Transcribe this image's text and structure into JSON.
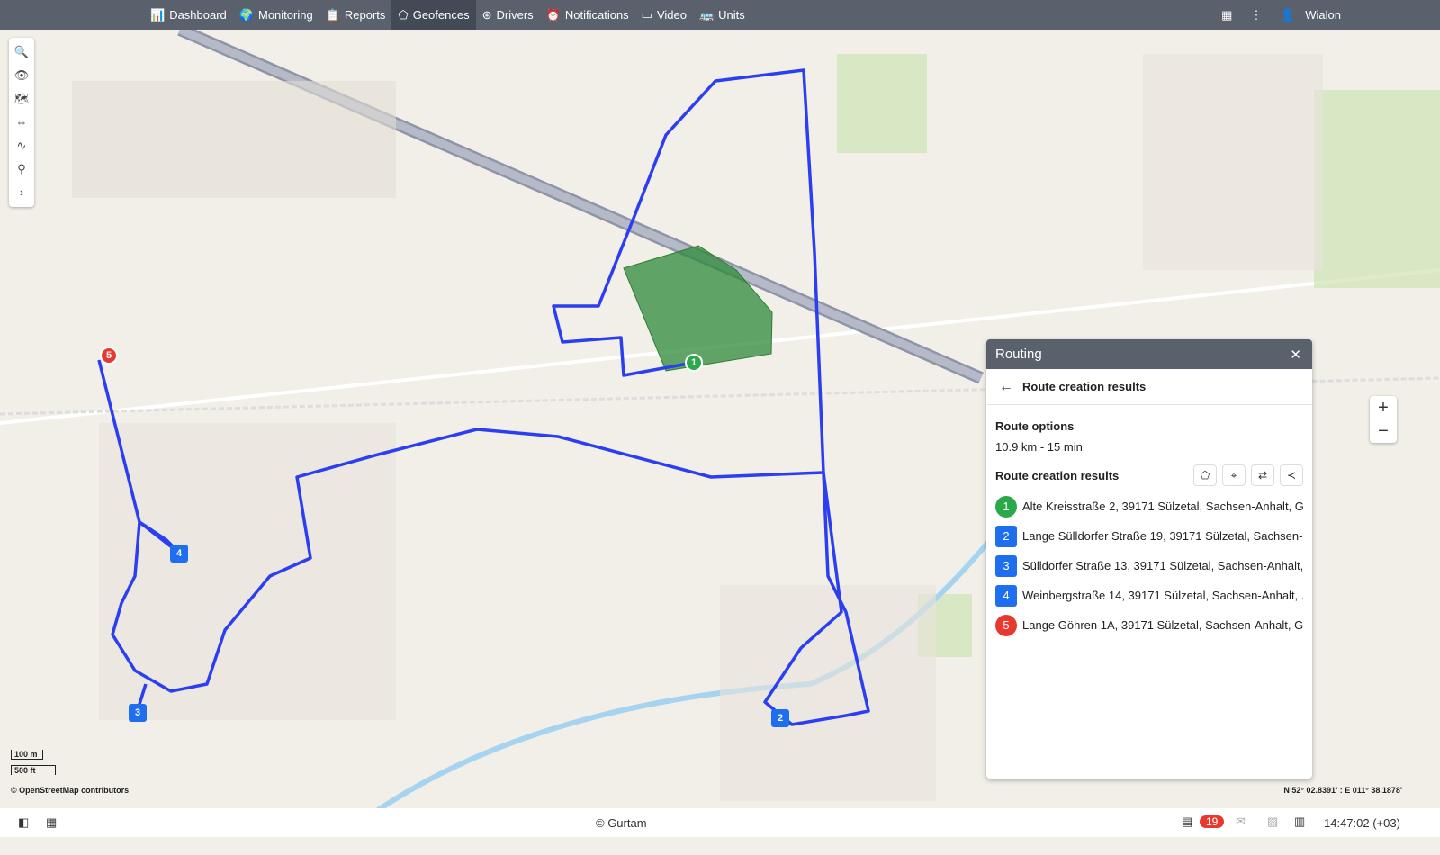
{
  "nav": {
    "items": [
      {
        "label": "Dashboard",
        "icon": "bar-chart-icon",
        "glyph": "📊"
      },
      {
        "label": "Monitoring",
        "icon": "globe-icon",
        "glyph": "🌍"
      },
      {
        "label": "Reports",
        "icon": "report-icon",
        "glyph": "📋"
      },
      {
        "label": "Geofences",
        "icon": "geofence-icon",
        "glyph": "⬠"
      },
      {
        "label": "Drivers",
        "icon": "steering-wheel-icon",
        "glyph": "⊛"
      },
      {
        "label": "Notifications",
        "icon": "alarm-icon",
        "glyph": "⏰"
      },
      {
        "label": "Video",
        "icon": "video-icon",
        "glyph": "▭"
      },
      {
        "label": "Units",
        "icon": "bus-icon",
        "glyph": "🚌"
      }
    ],
    "active": "Geofences",
    "user": "Wialon"
  },
  "map": {
    "scale_m": "100 m",
    "scale_ft": "500 ft",
    "attribution": "© OpenStreetMap contributors",
    "coordinates": "N 52° 02.8391' : E 011° 38.1878'",
    "route_color": "#2b3ff0",
    "geofence_color": "#2e8b3a"
  },
  "panel": {
    "title": "Routing",
    "subtitle": "Route creation results",
    "options_label": "Route options",
    "options_value": "10.9 km - 15 min",
    "results_label": "Route creation results",
    "points": [
      {
        "n": "1",
        "address": "Alte Kreisstraße 2, 39171 Sülzetal, Sachsen-Anhalt, G...",
        "color": "#2aa84a",
        "shape": "circle"
      },
      {
        "n": "2",
        "address": "Lange Sülldorfer Straße 19, 39171 Sülzetal, Sachsen-...",
        "color": "#1e6ff0",
        "shape": "square"
      },
      {
        "n": "3",
        "address": "Sülldorfer Straße 13, 39171 Sülzetal, Sachsen-Anhalt, ...",
        "color": "#1e6ff0",
        "shape": "square"
      },
      {
        "n": "4",
        "address": "Weinbergstraße 14, 39171 Sülzetal, Sachsen-Anhalt, ...",
        "color": "#1e6ff0",
        "shape": "square"
      },
      {
        "n": "5",
        "address": "Lange Göhren 1A, 39171 Sülzetal, Sachsen-Anhalt, Ge...",
        "color": "#e8392f",
        "shape": "circle"
      }
    ]
  },
  "footer": {
    "copyright": "© Gurtam",
    "notifications": "19",
    "time": "14:47:02 (+03)"
  }
}
